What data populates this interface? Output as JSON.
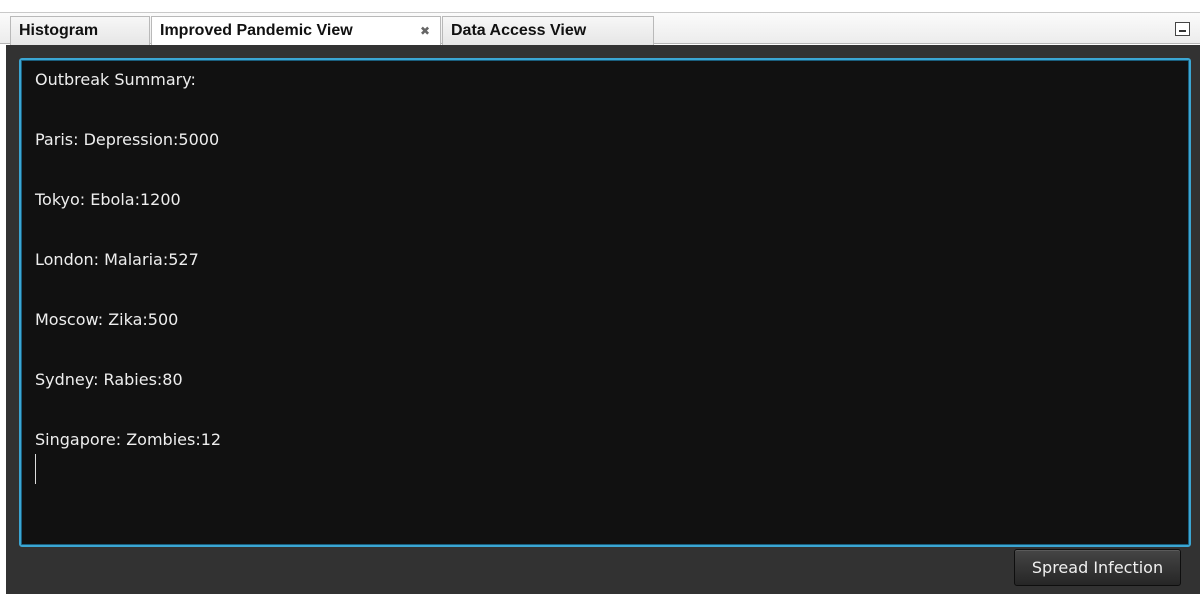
{
  "tabs": [
    {
      "label": "Histogram",
      "active": false
    },
    {
      "label": "Improved Pandemic View",
      "active": true,
      "close_icon": "close-icon"
    },
    {
      "label": "Data Access View",
      "active": false
    }
  ],
  "minimize_icon": "minimize-icon",
  "summary": {
    "lines": [
      "Outbreak Summary:",
      "Paris: Depression:5000",
      "Tokyo: Ebola:1200",
      "London: Malaria:527",
      "Moscow: Zika:500",
      "Sydney: Rabies:80",
      "Singapore: Zombies:12"
    ]
  },
  "actions": {
    "spread_label": "Spread Infection"
  },
  "colors": {
    "focus_border": "#3ba6d3",
    "text_area_bg": "#111111",
    "panel_bg": "#323232"
  }
}
